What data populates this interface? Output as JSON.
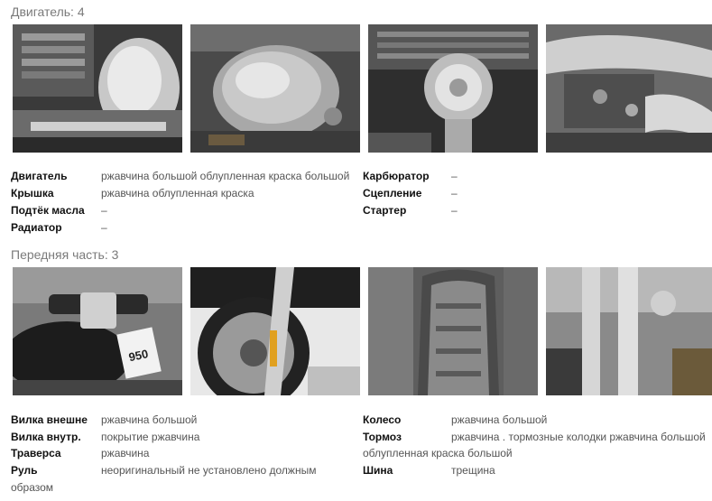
{
  "engine": {
    "title": "Двигатель: 4",
    "photos": [
      "engine-photo-1",
      "engine-photo-2",
      "engine-photo-3",
      "engine-photo-4"
    ],
    "left": [
      {
        "label": "Двигатель",
        "value": "ржавчина большой облупленная краска большой"
      },
      {
        "label": "Крышка",
        "value": "ржавчина облупленная краска"
      },
      {
        "label": "Подтёк масла",
        "value": "–"
      },
      {
        "label": "Радиатор",
        "value": "–"
      }
    ],
    "right": [
      {
        "label": "Карбюратор",
        "value": "–"
      },
      {
        "label": "Сцепление",
        "value": "–"
      },
      {
        "label": "Стартер",
        "value": "–"
      }
    ]
  },
  "front": {
    "title": "Передняя часть: 3",
    "photos": [
      "front-photo-1",
      "front-photo-2",
      "front-photo-3",
      "front-photo-4"
    ],
    "plate_text": "950",
    "left": [
      {
        "label": "Вилка внешне",
        "value": "ржавчина большой"
      },
      {
        "label": "Вилка внутр.",
        "value": "покрытие ржавчина"
      },
      {
        "label": "Траверса",
        "value": "ржавчина"
      },
      {
        "label": "Руль",
        "value": "неоригинальный не установлено должным",
        "continuation": "образом"
      }
    ],
    "right": [
      {
        "label": "Колесо",
        "value": "ржавчина большой"
      },
      {
        "label": "Тормоз",
        "value": "ржавчина . тормозные колодки ржавчина большой",
        "continuation": "облупленная краска большой"
      },
      {
        "label": "Шина",
        "value": "трещина"
      }
    ]
  }
}
